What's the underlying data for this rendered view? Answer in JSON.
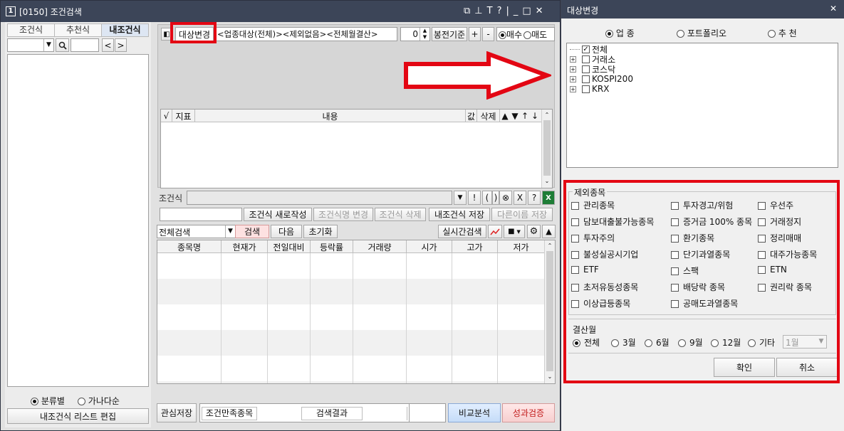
{
  "window": {
    "number": "1",
    "title": "[0150] 조건검색",
    "title_icons": [
      "⧉",
      "⊥",
      "T",
      "?",
      "|",
      "_",
      "□",
      "✕"
    ]
  },
  "left": {
    "tabs": [
      "조건식",
      "추천식",
      "내조건식"
    ],
    "arrows": [
      "<",
      ">"
    ],
    "radio_category": "분류별",
    "radio_alpha": "가나다순",
    "edit_button": "내조건식 리스트 편집"
  },
  "top": {
    "target_change_button": "대상변경",
    "target_desc": "<업종대상(전체)><제외없음><전체월결산>",
    "spinner_value": "0",
    "candle_basis": "봉전기준",
    "plus": "+",
    "minus": "-",
    "buy": "매수",
    "sell": "매도"
  },
  "indicator_table": {
    "headers": [
      "√",
      "지표",
      "내용",
      "값",
      "삭제",
      "▲",
      "▼",
      "↑",
      "↓"
    ]
  },
  "formula": {
    "label": "조건식",
    "op_buttons": [
      "▼",
      "!",
      "(",
      ")",
      "⊗",
      "X",
      "?"
    ],
    "new_button": "조건식 새로작성",
    "rename_button": "조건식명 변경",
    "delete_button": "조건식 삭제",
    "save_button": "내조건식 저장",
    "save_as_button": "다른이름 저장"
  },
  "search": {
    "scope": "전체검색",
    "search_button": "검색",
    "next_button": "다음",
    "reset_button": "초기화",
    "realtime_button": "실시간검색"
  },
  "results_table": {
    "headers": [
      "종목명",
      "현재가",
      "전일대비",
      "등락률",
      "거래량",
      "시가",
      "고가",
      "저가"
    ]
  },
  "bottom": {
    "watch_save": "관심저장",
    "match_label": "조건만족종목",
    "result_label": "검색결과",
    "compare_button": "비교분석",
    "perf_button": "성과검증"
  },
  "dialog": {
    "title": "대상변경",
    "close": "✕",
    "type_options": [
      "업 종",
      "포트폴리오",
      "추 천"
    ],
    "tree": [
      "전체",
      "거래소",
      "코스닥",
      "KOSPI200",
      "KRX"
    ],
    "exclusion_title": "제외종목",
    "exclusions": [
      [
        "관리종목",
        "투자경고/위험",
        "우선주"
      ],
      [
        "담보대출불가능종목",
        "증거금 100% 종목",
        "거래정지"
      ],
      [
        "투자주의",
        "환기종목",
        "정리매매"
      ],
      [
        "불성실공시기업",
        "단기과열종목",
        "대주가능종목"
      ],
      [
        "ETF",
        "스팩",
        "ETN"
      ],
      [
        "초저유동성종목",
        "배당락 종목",
        "권리락 종목"
      ],
      [
        "이상급등종목",
        "공매도과열종목",
        ""
      ]
    ],
    "settlement_title": "결산월",
    "settlement_options": [
      "전체",
      "3월",
      "6월",
      "9월",
      "12월",
      "기타"
    ],
    "month_select": "1월",
    "ok_button": "확인",
    "cancel_button": "취소"
  }
}
